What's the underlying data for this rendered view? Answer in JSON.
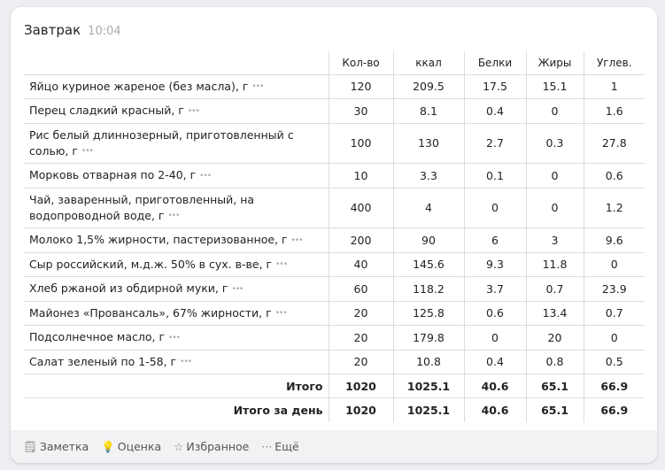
{
  "meal": {
    "title": "Завтрак",
    "time": "10:04"
  },
  "columns": [
    "Кол-во",
    "ккал",
    "Белки",
    "Жиры",
    "Углев."
  ],
  "rows": [
    {
      "name": "Яйцо куриное жареное (без масла), г",
      "v": [
        "120",
        "209.5",
        "17.5",
        "15.1",
        "1"
      ]
    },
    {
      "name": "Перец сладкий красный, г",
      "v": [
        "30",
        "8.1",
        "0.4",
        "0",
        "1.6"
      ]
    },
    {
      "name": "Рис белый длиннозерный, приготовленный с солью, г",
      "v": [
        "100",
        "130",
        "2.7",
        "0.3",
        "27.8"
      ]
    },
    {
      "name": "Морковь отварная по 2-40, г",
      "v": [
        "10",
        "3.3",
        "0.1",
        "0",
        "0.6"
      ]
    },
    {
      "name": "Чай, заваренный, приготовленный, на водопроводной воде, г",
      "v": [
        "400",
        "4",
        "0",
        "0",
        "1.2"
      ]
    },
    {
      "name": "Молоко 1,5% жирности, пастеризованное, г",
      "v": [
        "200",
        "90",
        "6",
        "3",
        "9.6"
      ]
    },
    {
      "name": "Сыр российский, м.д.ж. 50% в сух. в-ве, г",
      "v": [
        "40",
        "145.6",
        "9.3",
        "11.8",
        "0"
      ]
    },
    {
      "name": "Хлеб ржаной из обдирной муки, г",
      "v": [
        "60",
        "118.2",
        "3.7",
        "0.7",
        "23.9"
      ]
    },
    {
      "name": "Майонез «Провансаль», 67% жирности, г",
      "v": [
        "20",
        "125.8",
        "0.6",
        "13.4",
        "0.7"
      ]
    },
    {
      "name": "Подсолнечное масло, г",
      "v": [
        "20",
        "179.8",
        "0",
        "20",
        "0"
      ]
    },
    {
      "name": "Салат зеленый по 1-58, г",
      "v": [
        "20",
        "10.8",
        "0.4",
        "0.8",
        "0.5"
      ]
    }
  ],
  "totals": [
    {
      "label": "Итого",
      "v": [
        "1020",
        "1025.1",
        "40.6",
        "65.1",
        "66.9"
      ]
    },
    {
      "label": "Итого за день",
      "v": [
        "1020",
        "1025.1",
        "40.6",
        "65.1",
        "66.9"
      ]
    }
  ],
  "footer": {
    "note": "Заметка",
    "rating": "Оценка",
    "favorite": "Избранное",
    "more": "Ещё"
  }
}
